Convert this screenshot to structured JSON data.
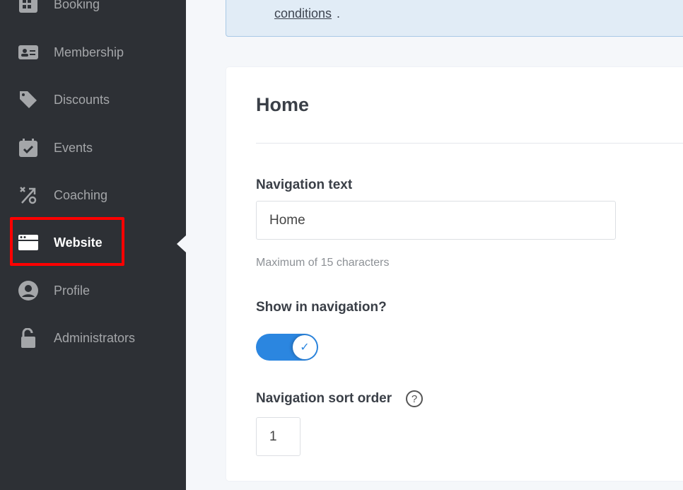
{
  "sidebar": {
    "items": [
      {
        "label": "Booking",
        "icon": "grid-calendar-icon"
      },
      {
        "label": "Membership",
        "icon": "id-card-icon"
      },
      {
        "label": "Discounts",
        "icon": "tags-icon"
      },
      {
        "label": "Events",
        "icon": "calendar-check-icon"
      },
      {
        "label": "Coaching",
        "icon": "coaching-icon"
      },
      {
        "label": "Website",
        "icon": "browser-window-icon",
        "active": true
      },
      {
        "label": "Profile",
        "icon": "user-circle-icon"
      },
      {
        "label": "Administrators",
        "icon": "unlock-icon"
      }
    ]
  },
  "info": {
    "link_text": "conditions",
    "trailing": "."
  },
  "card": {
    "title": "Home",
    "nav_text_label": "Navigation text",
    "nav_text_value": "Home",
    "nav_text_hint": "Maximum of 15 characters",
    "show_label": "Show in navigation?",
    "show_value": true,
    "sort_label": "Navigation sort order",
    "sort_value": "1",
    "help_glyph": "?"
  },
  "colors": {
    "sidebar": "#2d3035",
    "accent": "#2b86e0",
    "highlight": "#ff0000",
    "info_bg": "#e1ecf6"
  }
}
